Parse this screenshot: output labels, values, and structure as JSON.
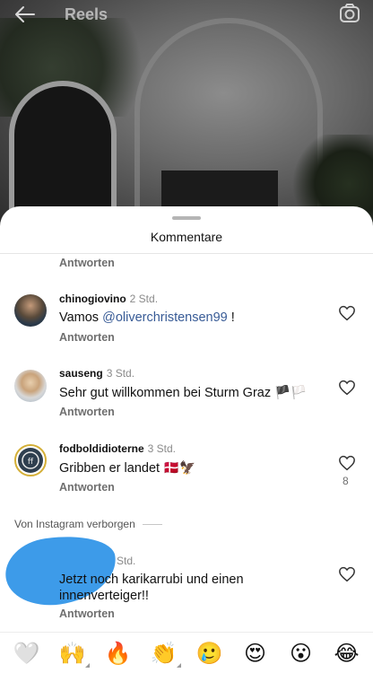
{
  "header": {
    "title": "Reels",
    "back_icon": "arrow-left-icon",
    "camera_icon": "camera-icon"
  },
  "sheet": {
    "title": "Kommentare"
  },
  "top_reply": {
    "label": "Antworten"
  },
  "comments": [
    {
      "username": "chinogiovino",
      "time": "2 Std.",
      "text_before": "Vamos ",
      "mention": "@oliverchristensen99",
      "text_after": " !",
      "reply": "Antworten"
    },
    {
      "username": "sauseng",
      "time": "3 Std.",
      "text": "Sehr gut willkommen bei Sturm Graz 🏴🏳️",
      "reply": "Antworten"
    },
    {
      "username": "fodboldidioterne",
      "time": "3 Std.",
      "text": "Gribben er landet 🇩🇰🦅",
      "reply": "Antworten",
      "likes": "8"
    },
    {
      "time": "Std.",
      "text_line1": "Jetzt noch karikarrubi und einen",
      "text_line2": "innenverteiger!!",
      "reply": "Antworten"
    }
  ],
  "hidden_section": {
    "label": "Von Instagram verborgen"
  },
  "emoji_bar": [
    "🤍",
    "🙌",
    "🔥",
    "👏",
    "🥲",
    "😍",
    "😮",
    "😂"
  ],
  "colors": {
    "mention": "#385b96",
    "redaction": "#3d9be9"
  }
}
